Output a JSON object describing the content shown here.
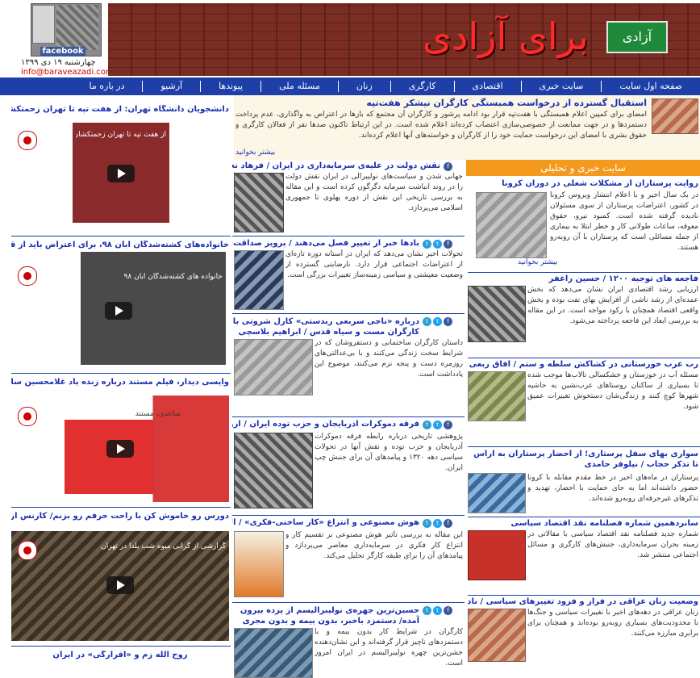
{
  "header": {
    "fb_label": "facebook",
    "date": "چهارشنبه ۱۹ دی ۱۳۹۹",
    "email": "info@baraveazadi.com",
    "banner_title": "برای آزادی",
    "banner_sign": "آزادی"
  },
  "nav": [
    "صفحه اول سایت",
    "سایت خبری",
    "اقتصادی",
    "کارگری",
    "زنان",
    "مسئله ملی",
    "پیوندها",
    "آرشیو",
    "در باره ما"
  ],
  "top_story": {
    "title": "استقبال گسترده از درخواست همبستگی کارگران نیشکر هفت‌تپه",
    "body": "امضای برای کمپین اعلام همبستگی با هفت‌تپه قرار بود ادامه پرشور و کارگران آن مجتمع که بارها در اعتراض به واگذاری، عدم پرداخت دستمزد‌ها و در جهت ممانعت از خصوصی‌سازی اعتصاب کرده‌اند اعلام شده است. در این ارتباط تاکنون صدها نفر از فعالان کارگری و حقوق بشری با امضای این درخواست حمایت خود را از کارگران و خواسته‌های آنها اعلام کرده‌اند.",
    "read_more": "بیشتر بخوانید"
  },
  "right_section": {
    "title": "سایت خبری و تحلیلی",
    "lead": {
      "title": "روایت پرستاران از مشکلات شغلی در دوران کرونا",
      "body": "در یک سال اخیر و با اعلام انتشار ویروس کرونا در کشور، اعتراضات پرستاران از سوی مسئولان نادیده گرفته شده است. کمبود نیرو، حقوق معوقه، ساعات طولانی کار و خطر ابتلا به بیماری از جمله مسائلی است که پرستاران با آن روبه‌رو هستند.",
      "read_more": "بیشتر بخوانید"
    },
    "items": [
      {
        "title": "فاجعه های توجیه ۱۲۰۰ / حسین راغفر",
        "body": "ارزیابی رشد اقتصادی ایران نشان می‌دهد که بخش عمده‌ای از رشد ناشی از افزایش بهای نفت بوده و بخش واقعی اقتصاد همچنان با رکود مواجه است. در این مقاله به بررسی ابعاد این فاجعه پرداخته می‌شود."
      },
      {
        "title": "رب عرب خورستانی در کشاکش سلطه و ستم / آفاق ربعی زاده",
        "body": "مسئله آب در خوزستان و خشکسالی تالاب‌ها موجب شده تا بسیاری از ساکنان روستاهای عرب‌نشین به حاشیه شهرها کوچ کنند و زندگی‌شان دستخوش تغییرات عمیق شود."
      },
      {
        "title": "سواری بهای سفل پرستاری؛ از احضار پرستاران به اراس تا تذکر حجاب / نیلوفر حامدی",
        "body": "پرستاران در ماه‌های اخیر در خط مقدم مقابله با کرونا حضور داشته‌اند اما به جای حمایت با احضار، تهدید و تذکرهای غیرحرفه‌ای روبه‌رو شده‌اند."
      },
      {
        "title": "سانردهمین شماره فصلنامه نقد اقتصاد سیاسی",
        "body": "شماره جدید فصلنامه نقد اقتصاد سیاسی با مقالاتی در زمینه بحران سرمایه‌داری، جنبش‌های کارگری و مسائل اجتماعی منتشر شد."
      },
      {
        "title": "وضعیت زنان عراقی در فراز و فرود تغییرهای سیاسی / نادیا محمود",
        "body": "زنان عراقی در دهه‌های اخیر با تغییرات سیاسی و جنگ‌ها با محدودیت‌های بسیاری روبه‌رو بوده‌اند و همچنان برای برابری مبارزه می‌کنند."
      }
    ]
  },
  "middle_articles": [
    {
      "title": "نقش دولت در علیه‌ی سرمایه‌داری در ایران / فرهاد نعمانی",
      "body": "جهانی شدن و سیاست‌های نولیبرالی در ایران نقش دولت را در روند انباشت سرمایه دگرگون کرده است و این مقاله به بررسی تاریخی این نقش از دوره پهلوی تا جمهوری اسلامی می‌پردازد."
    },
    {
      "title": "بادها خبر از تغییر فصل می‌دهند / پرویز صداقت",
      "body": "تحولات اخیر نشان می‌دهد که ایران در آستانه دوره تازه‌ای از اعتراضات اجتماعی قرار دارد. نارضایتی گسترده از وضعیت معیشتی و سیاسی زمینه‌ساز تغییرات بزرگی است."
    },
    {
      "title": "درباره «ناجی سربعی ربدستی» کارل شروتی با کارگران مست و سیاه قدس / ابراهیم بلاسچی",
      "body": "داستان کارگران ساختمانی و دستفروشان که در شرایط سخت زندگی می‌کنند و با بی‌عدالتی‌های روزمره دست و پنجه نرم می‌کنند، موضوع این یادداشت است."
    },
    {
      "title": "فرقه دموکرات آذربایجان و حزب توده ایران / آروند آبراهامیان",
      "body": "پژوهشی تاریخی درباره رابطه فرقه دموکرات آذربایجان و حزب توده و نقش آنها در تحولات سیاسی دهه ۱۳۲۰ و پیامدهای آن برای جنبش چپ ایران."
    },
    {
      "title": "هوش مصنوعی و انتراع «کار ساختی-فکری» / آل ای. بلکول",
      "body": "این مقاله به بررسی تأثیر هوش مصنوعی بر تقسیم کار و انتزاع کار فکری در سرمایه‌داری معاصر می‌پردازد و پیامدهای آن را برای طبقه کارگر تحلیل می‌کند."
    },
    {
      "title": "حسین‌ترین جهره‌ی نولیبرالیسم از پرده بیرون آمده/ دستمزد باخبر، بدون بیمه و بدون مجری سکاری! بسربس هزاره معدم",
      "body": "کارگران در شرایط کار بدون بیمه و با دستمزدهای ناچیز قرار گرفته‌اند و این نشان‌دهنده خشن‌ترین چهره نولیبرالیسم در ایران امروز است."
    }
  ],
  "left_videos": [
    {
      "heading": "دانشجویان دانشگاه تهران: از هفت تپه تا تهران زحمتکشان در زندان",
      "video_title": "از هفت تپه تا تهران زحمتکشان در زندان"
    },
    {
      "heading": "خانواده‌های کشته‌شدگان آبان ۹۸، برای اعتراض باید از قاتل محور بگیرند",
      "video_title": "خانواده های کشته‌شدگان آبان ۹۸"
    },
    {
      "heading": "وایسی دیدار، فیلم مستند درباره زنده یاد غلامحسین ساعدی",
      "video_title": "ساعدی، مستند"
    },
    {
      "heading": "دورس رو خاموش کن با راحت حرفم رو بزنم/ کارنس از گرانی شب یلدا",
      "video_title": "گزارشی از گرانی میوه شب یلدا در تهران"
    }
  ],
  "left_bottom": {
    "heading": "روح الله زم و «اقرارگی» در ایران"
  }
}
